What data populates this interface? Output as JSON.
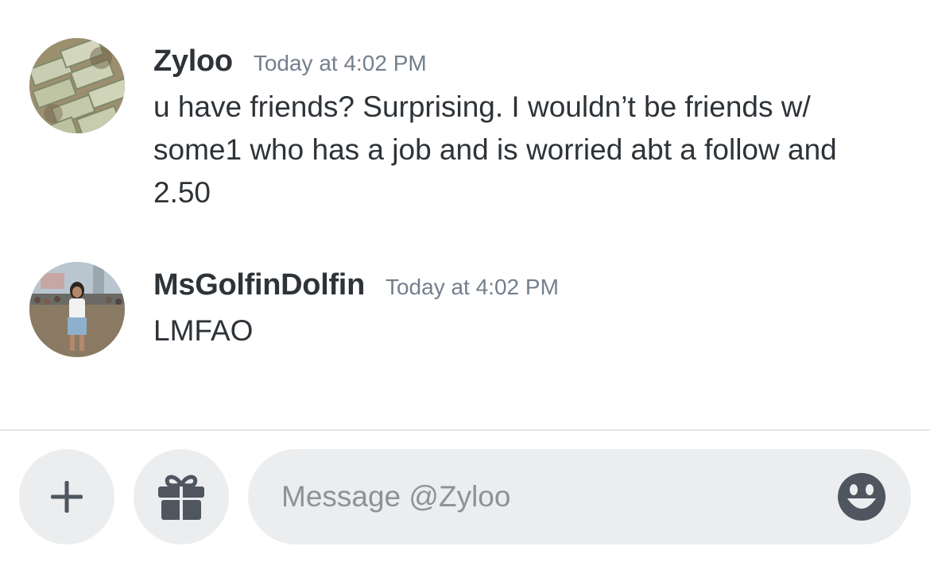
{
  "messages": [
    {
      "username": "Zyloo",
      "timestamp": "Today at 4:02 PM",
      "text": "u have friends? Surprising. I wouldn’t be friends w/ some1 who has a job and is worried abt a follow and 2.50",
      "avatar_icon": "money-stack-avatar"
    },
    {
      "username": "MsGolfinDolfin",
      "timestamp": "Today at 4:02 PM",
      "text": "LMFAO",
      "avatar_icon": "festival-photo-avatar"
    }
  ],
  "composer": {
    "placeholder": "Message @Zyloo",
    "value": "",
    "add_icon": "plus-icon",
    "gift_icon": "gift-icon",
    "emoji_icon": "emoji-smile-icon"
  },
  "colors": {
    "text": "#2e3338",
    "timestamp": "#747f8d",
    "input_background": "#ebedef",
    "placeholder": "#8e9297",
    "icon": "#4f5660"
  }
}
